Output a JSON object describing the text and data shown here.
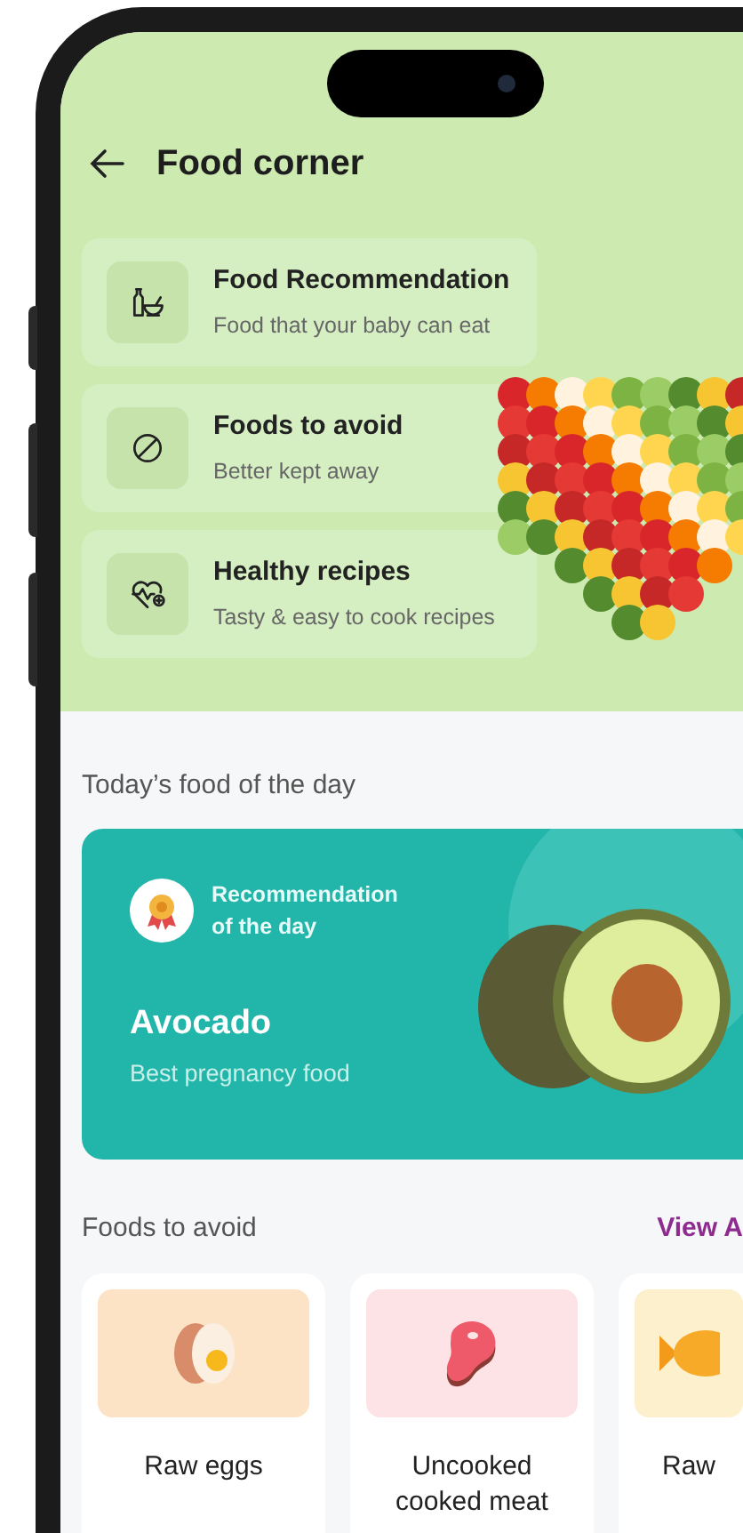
{
  "header": {
    "title": "Food corner"
  },
  "menu": [
    {
      "kind": "bottle-bowl",
      "title": "Food Recommendation",
      "subtitle": "Food that your baby can eat"
    },
    {
      "kind": "forbidden",
      "title": "Foods to avoid",
      "subtitle": "Better kept away"
    },
    {
      "kind": "heart-pulse",
      "title": "Healthy recipes",
      "subtitle": "Tasty & easy to cook recipes"
    }
  ],
  "today": {
    "heading": "Today’s food of the day",
    "badge": "Recommendation of the day",
    "name": "Avocado",
    "tagline": "Best pregnancy food"
  },
  "avoid": {
    "heading": "Foods to avoid",
    "link": "View A",
    "items": [
      {
        "kind": "egg",
        "label": "Raw eggs",
        "color": "#fde3c6"
      },
      {
        "kind": "meat",
        "label": "Uncooked cooked meat",
        "color": "#fde3e6"
      },
      {
        "kind": "fish",
        "label": "Raw",
        "color": "#fdf0cc"
      }
    ]
  }
}
